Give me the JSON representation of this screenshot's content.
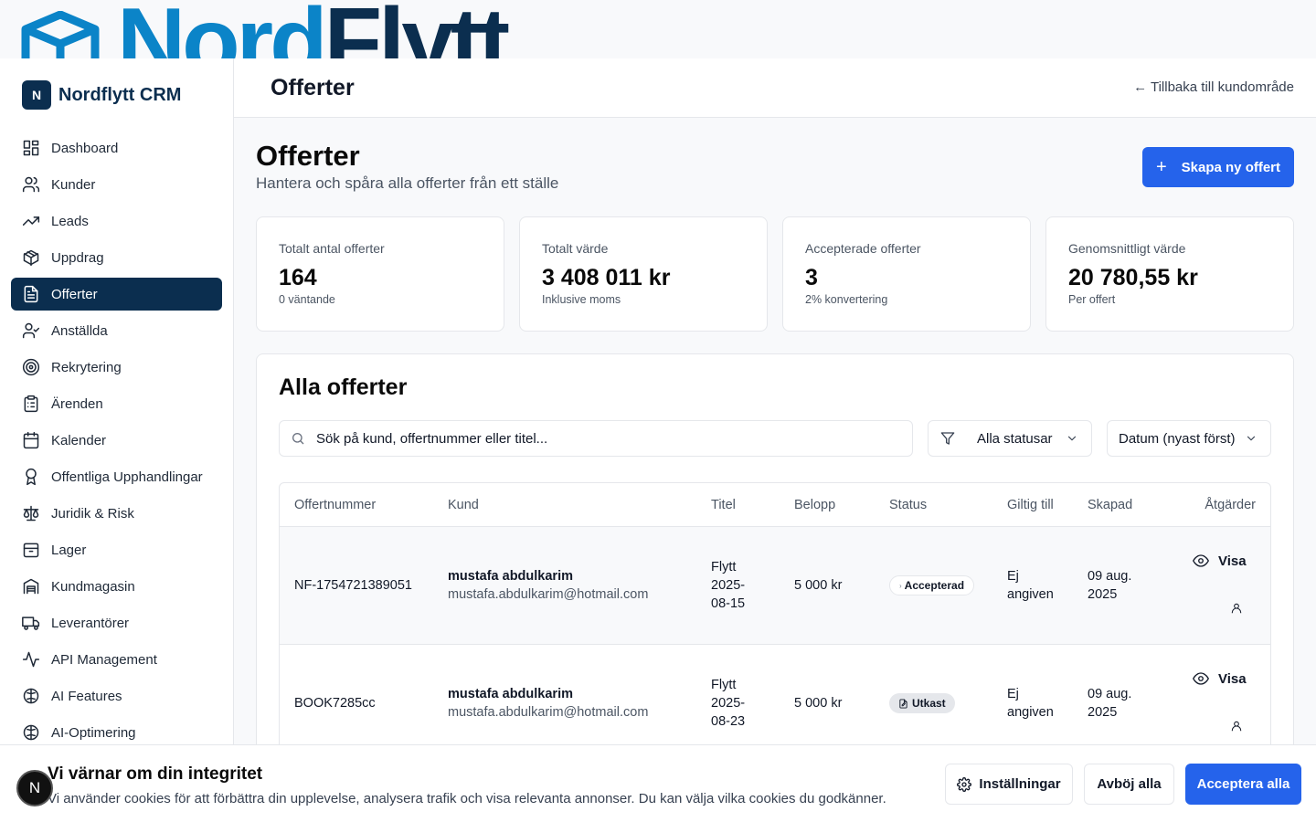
{
  "banner": {
    "word_blue": "Nord",
    "word_dark": "Flytt"
  },
  "sidebar": {
    "logo_letter": "N",
    "title": "Nordflytt CRM",
    "items": [
      {
        "label": "Dashboard",
        "icon": "dashboard-icon"
      },
      {
        "label": "Kunder",
        "icon": "users-icon"
      },
      {
        "label": "Leads",
        "icon": "trending-up-icon"
      },
      {
        "label": "Uppdrag",
        "icon": "package-icon"
      },
      {
        "label": "Offerter",
        "icon": "file-text-icon",
        "active": true
      },
      {
        "label": "Anställda",
        "icon": "user-check-icon"
      },
      {
        "label": "Rekrytering",
        "icon": "target-icon"
      },
      {
        "label": "Ärenden",
        "icon": "clipboard-icon"
      },
      {
        "label": "Kalender",
        "icon": "calendar-icon"
      },
      {
        "label": "Offentliga Upphandlingar",
        "icon": "award-icon"
      },
      {
        "label": "Juridik & Risk",
        "icon": "scale-icon"
      },
      {
        "label": "Lager",
        "icon": "box-icon"
      },
      {
        "label": "Kundmagasin",
        "icon": "warehouse-icon"
      },
      {
        "label": "Leverantörer",
        "icon": "truck-icon"
      },
      {
        "label": "API Management",
        "icon": "activity-icon"
      },
      {
        "label": "AI Features",
        "icon": "brain-icon"
      },
      {
        "label": "AI-Optimering",
        "icon": "brain-icon"
      }
    ]
  },
  "header": {
    "title": "Offerter",
    "back_link": "← Tillbaka till kundområde"
  },
  "page": {
    "title": "Offerter",
    "subtitle": "Hantera och spåra alla offerter från ett ställe",
    "create_button": "Skapa ny offert"
  },
  "stats": [
    {
      "label": "Totalt antal offerter",
      "value": "164",
      "sub": "0 väntande"
    },
    {
      "label": "Totalt värde",
      "value": "3 408 011 kr",
      "sub": "Inklusive moms"
    },
    {
      "label": "Accepterade offerter",
      "value": "3",
      "sub": "2% konvertering"
    },
    {
      "label": "Genomsnittligt värde",
      "value": "20 780,55 kr",
      "sub": "Per offert"
    }
  ],
  "list": {
    "title": "Alla offerter",
    "search_placeholder": "Sök på kund, offertnummer eller titel...",
    "status_filter": "Alla statusar",
    "sort": "Datum (nyast först)",
    "columns": [
      "Offertnummer",
      "Kund",
      "Titel",
      "Belopp",
      "Status",
      "Giltig till",
      "Skapad",
      "Åtgärder"
    ],
    "rows": [
      {
        "number": "NF-1754721389051",
        "customer": "mustafa abdulkarim",
        "email": "mustafa.abdulkarim@hotmail.com",
        "title_l1": "Flytt",
        "title_l2": "2025-",
        "title_l3": "08-15",
        "amount": "5 000 kr",
        "status": "Accepterad",
        "valid_l1": "Ej",
        "valid_l2": "angiven",
        "created_l1": "09 aug.",
        "created_l2": "2025",
        "view": "Visa"
      },
      {
        "number": "BOOK7285cc",
        "customer": "mustafa abdulkarim",
        "email": "mustafa.abdulkarim@hotmail.com",
        "title_l1": "Flytt",
        "title_l2": "2025-",
        "title_l3": "08-23",
        "amount": "5 000 kr",
        "status": "Utkast",
        "valid_l1": "Ej",
        "valid_l2": "angiven",
        "created_l1": "09 aug.",
        "created_l2": "2025",
        "view": "Visa"
      }
    ]
  },
  "cookie": {
    "title": "Vi värnar om din integritet",
    "text": "Vi använder cookies för att förbättra din upplevelse, analysera trafik och visa relevanta annonser. Du kan välja vilka cookies du godkänner.",
    "settings": "Inställningar",
    "reject": "Avböj alla",
    "accept": "Acceptera alla"
  },
  "fab_letter": "N",
  "colors": {
    "brand_dark": "#0b2e4f",
    "brand_blue": "#0b84c8",
    "primary": "#2563eb"
  }
}
